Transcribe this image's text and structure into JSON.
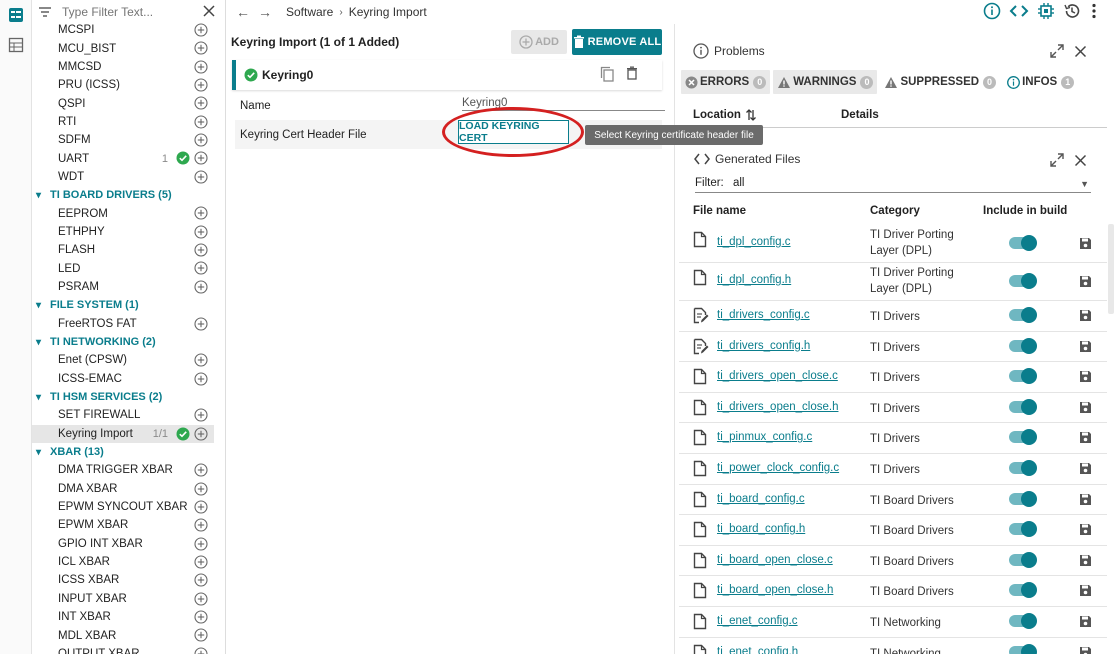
{
  "filter": {
    "placeholder": "Type Filter Text..."
  },
  "tree": [
    {
      "kind": "item",
      "label": "MCSPI"
    },
    {
      "kind": "item",
      "label": "MCU_BIST"
    },
    {
      "kind": "item",
      "label": "MMCSD"
    },
    {
      "kind": "item",
      "label": "PRU (ICSS)"
    },
    {
      "kind": "item",
      "label": "QSPI"
    },
    {
      "kind": "item",
      "label": "RTI"
    },
    {
      "kind": "item",
      "label": "SDFM"
    },
    {
      "kind": "item",
      "label": "UART",
      "count": "1",
      "ok": true
    },
    {
      "kind": "item",
      "label": "WDT"
    },
    {
      "kind": "group",
      "label": "TI BOARD DRIVERS (5)"
    },
    {
      "kind": "item",
      "label": "EEPROM"
    },
    {
      "kind": "item",
      "label": "ETHPHY"
    },
    {
      "kind": "item",
      "label": "FLASH"
    },
    {
      "kind": "item",
      "label": "LED"
    },
    {
      "kind": "item",
      "label": "PSRAM"
    },
    {
      "kind": "group",
      "label": "FILE SYSTEM (1)"
    },
    {
      "kind": "item",
      "label": "FreeRTOS FAT"
    },
    {
      "kind": "group",
      "label": "TI NETWORKING (2)"
    },
    {
      "kind": "item",
      "label": "Enet (CPSW)"
    },
    {
      "kind": "item",
      "label": "ICSS-EMAC"
    },
    {
      "kind": "group",
      "label": "TI HSM SERVICES (2)"
    },
    {
      "kind": "item",
      "label": "SET FIREWALL"
    },
    {
      "kind": "item",
      "label": "Keyring Import",
      "count": "1/1",
      "ok": true,
      "selected": true
    },
    {
      "kind": "group",
      "label": "XBAR (13)"
    },
    {
      "kind": "item",
      "label": "DMA TRIGGER XBAR"
    },
    {
      "kind": "item",
      "label": "DMA XBAR"
    },
    {
      "kind": "item",
      "label": "EPWM SYNCOUT XBAR"
    },
    {
      "kind": "item",
      "label": "EPWM XBAR"
    },
    {
      "kind": "item",
      "label": "GPIO INT XBAR"
    },
    {
      "kind": "item",
      "label": "ICL XBAR"
    },
    {
      "kind": "item",
      "label": "ICSS XBAR"
    },
    {
      "kind": "item",
      "label": "INPUT XBAR"
    },
    {
      "kind": "item",
      "label": "INT XBAR"
    },
    {
      "kind": "item",
      "label": "MDL XBAR"
    },
    {
      "kind": "item",
      "label": "OUTPUT XBAR"
    }
  ],
  "breadcrumb": {
    "root": "Software",
    "current": "Keyring Import"
  },
  "center": {
    "title": "Keyring Import (1 of 1 Added)",
    "add_label": "ADD",
    "remove_all_label": "REMOVE ALL",
    "instance_label": "Keyring0",
    "props": {
      "name_label": "Name",
      "name_value": "Keyring0",
      "cert_label": "Keyring Cert Header File",
      "load_label": "LOAD KEYRING CERT",
      "tooltip": "Select Keyring certificate header file"
    }
  },
  "problems": {
    "title": "Problems",
    "chips": [
      {
        "label": "ERRORS",
        "count": "0",
        "icon": "error-icon"
      },
      {
        "label": "WARNINGS",
        "count": "0",
        "icon": "warning-icon"
      },
      {
        "label": "SUPPRESSED",
        "count": "0",
        "icon": "suppressed-icon"
      },
      {
        "label": "INFOS",
        "count": "1",
        "icon": "info-icon"
      }
    ],
    "col_location": "Location",
    "col_details": "Details"
  },
  "generated": {
    "title": "Generated Files",
    "filter_label": "Filter:",
    "filter_value": "all",
    "col_file": "File name",
    "col_category": "Category",
    "col_include": "Include in build",
    "rows": [
      {
        "name": "ti_dpl_config.c",
        "category": "TI Driver Porting Layer (DPL)",
        "icon": "file-icon"
      },
      {
        "name": "ti_dpl_config.h",
        "category": "TI Driver Porting Layer (DPL)",
        "icon": "file-icon"
      },
      {
        "name": "ti_drivers_config.c",
        "category": "TI Drivers",
        "icon": "file-edit-icon"
      },
      {
        "name": "ti_drivers_config.h",
        "category": "TI Drivers",
        "icon": "file-edit-icon"
      },
      {
        "name": "ti_drivers_open_close.c",
        "category": "TI Drivers",
        "icon": "file-icon"
      },
      {
        "name": "ti_drivers_open_close.h",
        "category": "TI Drivers",
        "icon": "file-icon"
      },
      {
        "name": "ti_pinmux_config.c",
        "category": "TI Drivers",
        "icon": "file-icon"
      },
      {
        "name": "ti_power_clock_config.c",
        "category": "TI Drivers",
        "icon": "file-icon"
      },
      {
        "name": "ti_board_config.c",
        "category": "TI Board Drivers",
        "icon": "file-icon"
      },
      {
        "name": "ti_board_config.h",
        "category": "TI Board Drivers",
        "icon": "file-icon"
      },
      {
        "name": "ti_board_open_close.c",
        "category": "TI Board Drivers",
        "icon": "file-icon"
      },
      {
        "name": "ti_board_open_close.h",
        "category": "TI Board Drivers",
        "icon": "file-icon"
      },
      {
        "name": "ti_enet_config.c",
        "category": "TI Networking",
        "icon": "file-icon"
      },
      {
        "name": "ti_enet_config.h",
        "category": "TI Networking",
        "icon": "file-icon"
      }
    ]
  },
  "colors": {
    "accent": "#0a7d8c",
    "ok": "#2ea84f",
    "annotation": "#d42020"
  }
}
